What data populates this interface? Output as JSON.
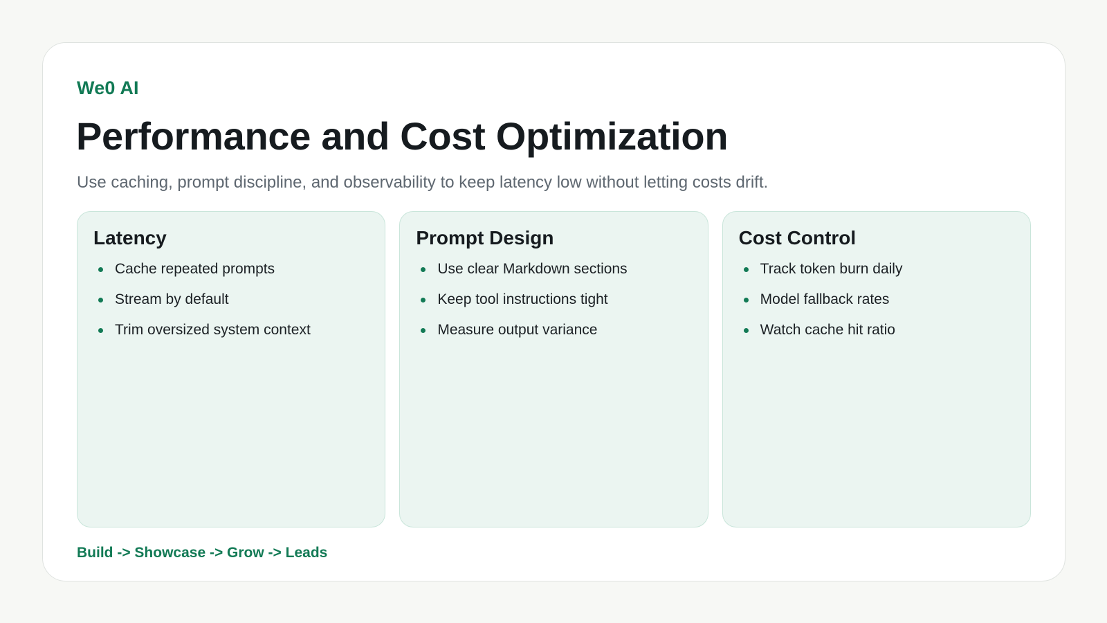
{
  "brand": "We0 AI",
  "title": "Performance and Cost Optimization",
  "subtitle": "Use caching, prompt discipline, and observability to keep latency low without letting costs drift.",
  "cards": [
    {
      "title": "Latency",
      "items": [
        "Cache repeated prompts",
        "Stream by default",
        "Trim oversized system context"
      ]
    },
    {
      "title": "Prompt Design",
      "items": [
        "Use clear Markdown sections",
        "Keep tool instructions tight",
        "Measure output variance"
      ]
    },
    {
      "title": "Cost Control",
      "items": [
        "Track token burn daily",
        "Model fallback rates",
        "Watch cache hit ratio"
      ]
    }
  ],
  "footer": "Build -> Showcase -> Grow -> Leads",
  "colors": {
    "accent": "#127a55",
    "card_background": "#ebf5f1",
    "card_border": "#c9e5da",
    "page_background": "#f7f8f5"
  }
}
